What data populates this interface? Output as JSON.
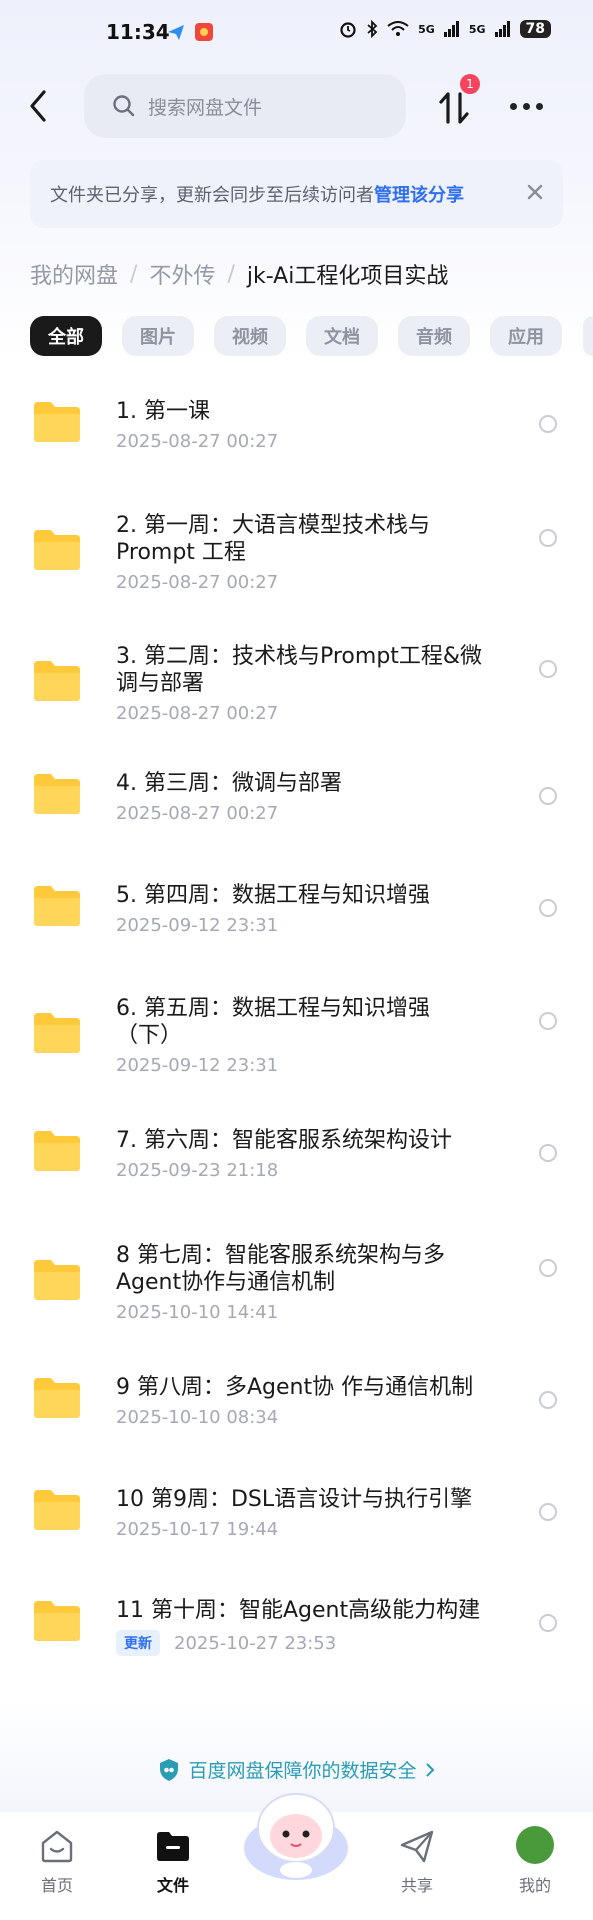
{
  "status_bar": {
    "time": "11:34",
    "signal_1": "5G",
    "signal_2": "5G",
    "battery": "78"
  },
  "header": {
    "search_placeholder": "搜索网盘文件",
    "transfer_badge": "1"
  },
  "share_banner": {
    "text": "文件夹已分享，更新会同步至后续访问者",
    "link": "管理该分享"
  },
  "breadcrumb": {
    "items": [
      "我的网盘",
      "不外传"
    ],
    "separator": "/",
    "current": "jk-Ai工程化项目实战"
  },
  "filters": [
    "全部",
    "图片",
    "视频",
    "文档",
    "音频",
    "应用"
  ],
  "files": [
    {
      "name_lines": [
        "1. 第一课"
      ],
      "date": "2025-08-27 00:27"
    },
    {
      "name_lines": [
        "2. 第一周：大语言模型技术栈与",
        "Prompt 工程"
      ],
      "date": "2025-08-27 00:27"
    },
    {
      "name_lines": [
        "3. 第二周：技术栈与Prompt工程&微",
        "调与部署"
      ],
      "date": "2025-08-27 00:27"
    },
    {
      "name_lines": [
        "4. 第三周：微调与部署"
      ],
      "date": "2025-08-27 00:27"
    },
    {
      "name_lines": [
        "5. 第四周：数据工程与知识增强"
      ],
      "date": "2025-09-12 23:31"
    },
    {
      "name_lines": [
        "6. 第五周：数据工程与知识增强",
        "（下）"
      ],
      "date": "2025-09-12 23:31"
    },
    {
      "name_lines": [
        "7. 第六周：智能客服系统架构设计"
      ],
      "date": "2025-09-23 21:18"
    },
    {
      "name_lines": [
        "8  第七周：智能客服系统架构与多",
        "Agent协作与通信机制"
      ],
      "date": "2025-10-10 14:41"
    },
    {
      "name_lines": [
        "9  第八周：多Agent协 作与通信机制"
      ],
      "date": "2025-10-10 08:34"
    },
    {
      "name_lines": [
        "10  第9周：DSL语言设计与执行引擎"
      ],
      "date": "2025-10-17 19:44"
    },
    {
      "name_lines": [
        "11 第十周：智能Agent高级能力构建"
      ],
      "date": "2025-10-27 23:53",
      "tag": "更新"
    }
  ],
  "safety_text": "百度网盘保障你的数据安全",
  "bottom_nav": {
    "home": "首页",
    "files": "文件",
    "share": "共享",
    "mine": "我的"
  },
  "colors": {
    "accent": "#2f6ff0",
    "folder": "#ffc93c",
    "badge": "#f5455c",
    "safety": "#2a9cb3"
  }
}
